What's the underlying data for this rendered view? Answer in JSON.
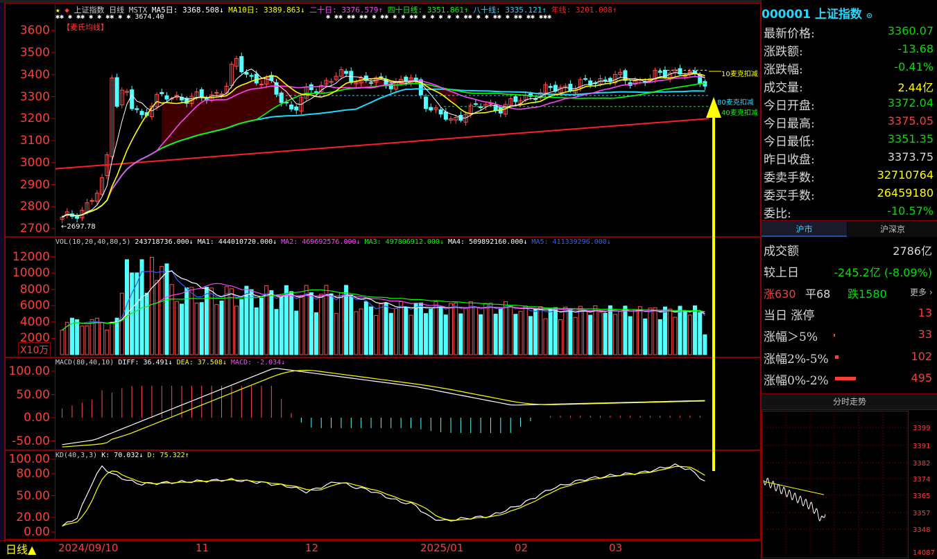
{
  "main": {
    "header": {
      "star": "★",
      "index_name": "上证指数",
      "period": "日线",
      "indicator": "MSTX",
      "ma10": "MA10日: 3389.863↓",
      "ma20": "二十日: 3376.579↑",
      "ma40": "四十日线: 3351.861↑",
      "ma80": "八十线: 3335.121↑",
      "ma_last": "年线: 3201.008↑",
      "ma5_partial": "MA5日: 3368.508↓",
      "high_mark": "3674.40",
      "mai_label": "【麦氏均线】"
    },
    "y_labels": [
      "3600",
      "3500",
      "3400",
      "3300",
      "3200",
      "3100",
      "3000",
      "2900",
      "2800",
      "2700"
    ],
    "low_mark": "2697.78",
    "annotations": [
      "10麦克扣减",
      "80麦克扣减",
      "40麦克扣减"
    ],
    "colors": {
      "up": "#ff5050",
      "down": "#54ffff",
      "ma5": "#ffffff",
      "ma10": "#ffff00",
      "ma20": "#ff44ff",
      "ma40": "#00ff00",
      "ma80": "#22d8ff",
      "yearline": "#ff2020"
    }
  },
  "vol": {
    "header_left": "VOL(10,20,40,80,5)",
    "header_value": "243718736.000↓",
    "ma1": "MA1: 444010720.000↓",
    "ma2": "MA2: 469692576.000↓",
    "ma3": "MA3: 497806912.000↓",
    "ma4": "MA4: 509892160.000↓",
    "ma5": "MA5: 411339296.000↓",
    "y_labels": [
      "12000",
      "10000",
      "8000",
      "6000",
      "4000",
      "2000"
    ],
    "unit": "X10万"
  },
  "macd": {
    "header": "MACD(80,40,10)",
    "diff": "DIFF: 36.491↓",
    "dea": "DEA: 37.508↓",
    "macd": "MACD: -2.034↓",
    "y_labels": [
      "100.00",
      "50.00",
      "0.00",
      "-50.00"
    ]
  },
  "kd": {
    "header": "KD(40,3,3)",
    "k": "K: 70.032↓",
    "d": "D: 75.322↑",
    "y_labels": [
      "100.00",
      "80.00",
      "50.00",
      "20.00",
      "0.00"
    ]
  },
  "x_axis": {
    "period_button": "日线▲",
    "dates": [
      "2024/09/10",
      "11",
      "12",
      "2025/01",
      "02",
      "03"
    ]
  },
  "quote": {
    "code_name": "000001 上证指数",
    "rows": [
      {
        "k": "最新价格:",
        "v": "3360.07",
        "c": "green"
      },
      {
        "k": "涨跌额:",
        "v": "-13.68",
        "c": "green"
      },
      {
        "k": "涨跌幅:",
        "v": "-0.41%",
        "c": "green"
      },
      {
        "k": "成交量:",
        "v": "2.44亿",
        "c": "yellow"
      },
      {
        "k": "今日开盘:",
        "v": "3372.04",
        "c": "green"
      },
      {
        "k": "今日最高:",
        "v": "3375.05",
        "c": "red"
      },
      {
        "k": "今日最低:",
        "v": "3351.35",
        "c": "green"
      },
      {
        "k": "昨日收盘:",
        "v": "3373.75",
        "c": "white"
      },
      {
        "k": "委卖手数:",
        "v": "32710764",
        "c": "yellow"
      },
      {
        "k": "委买手数:",
        "v": "26459180",
        "c": "yellow"
      },
      {
        "k": "委比:",
        "v": "-10.57%",
        "c": "green"
      }
    ],
    "tabs": [
      "沪市",
      "沪深京"
    ],
    "turnover_label": "成交额",
    "turnover_value": "2786亿",
    "vs_label": "较上日",
    "vs_value": "-245.2亿 (-8.09%)",
    "up_count": "涨630",
    "flat_count": "平68",
    "down_count": "跌1580",
    "more": "更多 ›",
    "limit_up_label": "当日 涨停",
    "limit_up_value": "13",
    "gt5_label": "涨幅＞5%",
    "gt5_value": "33",
    "r2_5_label": "涨幅2%-5%",
    "r2_5_value": "102",
    "r0_2_label": "涨幅0%-2%",
    "r0_2_value": "495"
  },
  "intraday": {
    "title": "分时走势",
    "y_labels": [
      "3399",
      "3391",
      "3382",
      "3374",
      "3365",
      "3357",
      "3348",
      "14087"
    ]
  }
}
